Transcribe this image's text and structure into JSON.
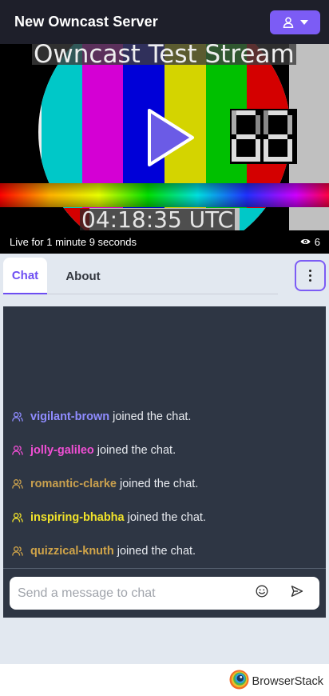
{
  "header": {
    "title": "New Owncast Server",
    "user_menu_icon": "user-icon",
    "user_menu_caret": "caret-down-icon",
    "accent": "#7c5cf5"
  },
  "video": {
    "overlay_title": "Owncast Test Stream",
    "overlay_time": "04:18:35 UTC",
    "play_icon": "play-icon",
    "status": {
      "live_text": "Live for 1 minute 9 seconds",
      "viewer_icon": "eye-icon",
      "viewer_count": "6"
    }
  },
  "tabs": {
    "items": [
      {
        "label": "Chat",
        "active": true
      },
      {
        "label": "About",
        "active": false
      }
    ],
    "menu_icon": "more-vertical-icon"
  },
  "chat": {
    "messages": [
      {
        "username": "vigilant-brown",
        "text": "joined the chat.",
        "color": "#8f8cff",
        "icon": "users-icon"
      },
      {
        "username": "jolly-galileo",
        "text": "joined the chat.",
        "color": "#f04fd4",
        "icon": "users-icon"
      },
      {
        "username": "romantic-clarke",
        "text": "joined the chat.",
        "color": "#c9a04e",
        "icon": "users-icon"
      },
      {
        "username": "inspiring-bhabha",
        "text": "joined the chat.",
        "color": "#f1e32b",
        "icon": "users-icon"
      },
      {
        "username": "quizzical-knuth",
        "text": "joined the chat.",
        "color": "#d0a449",
        "icon": "users-icon"
      }
    ],
    "input_placeholder": "Send a message to chat",
    "emoji_icon": "smile-icon",
    "send_icon": "send-icon"
  },
  "footer": {
    "brand": "BrowserStack",
    "logo_icon": "browserstack-logo-icon"
  }
}
